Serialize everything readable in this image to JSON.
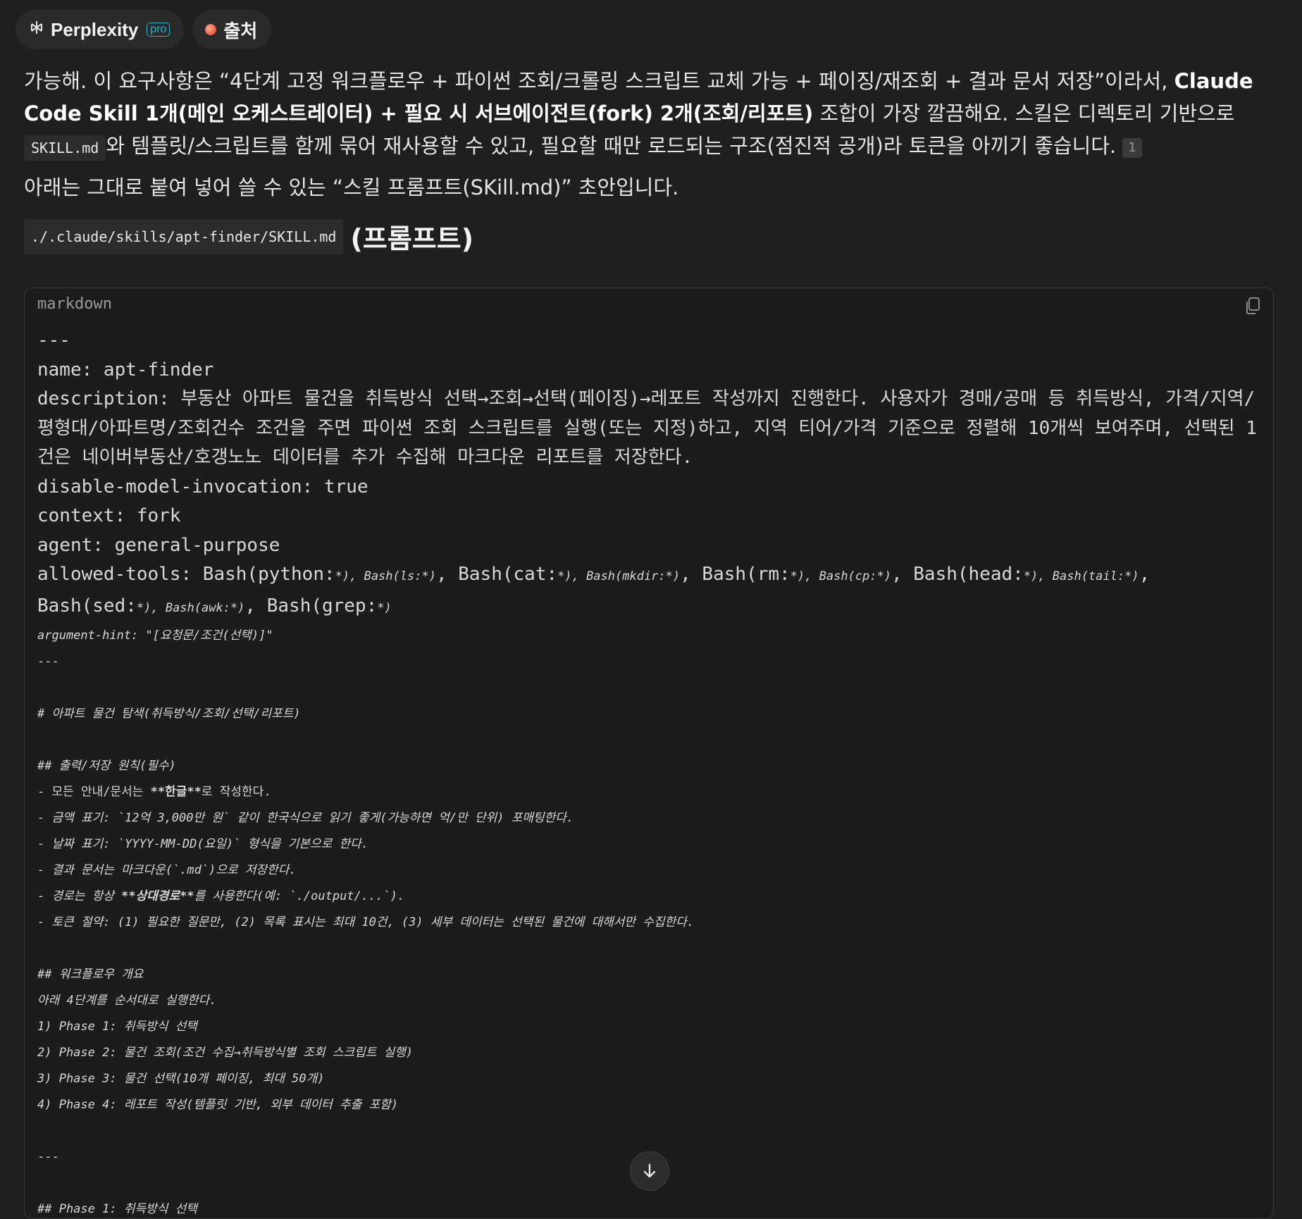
{
  "tabs": {
    "perplexity_label": "Perplexity",
    "pro_badge": "pro",
    "sources_label": "출처"
  },
  "answer": {
    "p1_part1": "가능해. 이 요구사항은 “4단계 고정 워크플로우 + 파이썬 조회/크롤링 스크립트 교체 가능 + 페이징/재조회 + 결과 문서 저장”이라서, ",
    "p1_bold": "Claude Code Skill 1개(메인 오케스트레이터) + 필요 시 서브에이전트(fork) 2개(조회/리포트)",
    "p1_part2": " 조합이 가장 깔끔해요. 스킬은 디렉토리 기반으로 ",
    "p1_code": "SKILL.md",
    "p1_part3": "와 템플릿/스크립트를 함께 묶어 재사용할 수 있고, 필요할 때만 로드되는 구조(점진적 공개)라 토큰을 아끼기 좋습니다.",
    "citation": "1",
    "p2": "아래는 그대로 붙여 넣어 쓸 수 있는 “스킬 프롬프트(SKill.md)” 초안입니다."
  },
  "heading": {
    "path": "./.claude/skills/apt-finder/SKILL.md",
    "text": "(프롬프트)"
  },
  "codeblock": {
    "language": "markdown",
    "fm_sep": "---",
    "name_line": "name: apt-finder",
    "description_line": "description: 부동산 아파트 물건을 취득방식 선택→조회→선택(페이징)→레포트 작성까지 진행한다. 사용자가 경매/공매 등 취득방식, 가격/지역/평형대/아파트명/조회건수 조건을 주면 파이썬 조회 스크립트를 실행(또는 지정)하고, 지역 티어/가격 기준으로 정렬해 10개씩 보여주며, 선택된 1건은 네이버부동산/호갱노노 데이터를 추가 수집해 마크다운 리포트를 저장한다.",
    "disable_line": "disable-model-invocation: true",
    "context_line": "context: fork",
    "agent_line": "agent: general-purpose",
    "tools_a1": "allowed-tools: Bash(python:",
    "tools_a2": "*), Bash(ls:*)",
    "tools_b1": ", Bash(cat:",
    "tools_b2": "*), Bash(mkdir:*)",
    "tools_c1": ", Bash(rm:",
    "tools_c2": "*), Bash(cp:*)",
    "tools_d1": ", Bash(head:",
    "tools_d2": "*), Bash(tail:*)",
    "tools_e1": ", Bash(sed:",
    "tools_e2": "*), Bash(awk:*)",
    "tools_f1": ", Bash(grep:",
    "tools_f2": "*)",
    "argument_hint": "argument-hint: \"[요청문/조건(선택)]\"",
    "fm_end": "---",
    "title_line": "# 아파트 물건 탐색(취득방식/조회/선택/리포트)",
    "section1": "## 출력/저장 원칙(필수)",
    "rule1_pre": "- 모든 안내/문서는 ",
    "rule1_bold": "**한글**",
    "rule1_post": "로 작성한다.",
    "rule2": "- 금액 표기: `12억 3,000만 원` 같이 한국식으로 읽기 좋게(가능하면 억/만 단위) 포매팅한다.",
    "rule3": "- 날짜 표기: `YYYY-MM-DD(요일)` 형식을 기본으로 한다.",
    "rule4": "- 결과 문서는 마크다운(`.md`)으로 저장한다.",
    "rule5_pre": "- 경로는 항상 ",
    "rule5_bold": "**상대경로**",
    "rule5_post": "를 사용한다(예: `./output/...`).",
    "rule6": "- 토큰 절약: (1) 필요한 질문만, (2) 목록 표시는 최대 10건, (3) 세부 데이터는 선택된 물건에 대해서만 수집한다.",
    "section2": "## 워크플로우 개요",
    "overview": "아래 4단계를 순서대로 실행한다.",
    "phase1": "1) Phase 1: 취득방식 선택",
    "phase2": "2) Phase 2: 물건 조회(조건 수집→취득방식별 조회 스크립트 실행)",
    "phase3": "3) Phase 3: 물건 선택(10개 페이징, 최대 50개)",
    "phase4": "4) Phase 4: 레포트 작성(템플릿 기반, 외부 데이터 추출 포함)",
    "sep2": "---",
    "next_section": "## Phase 1: 취득방식 선택"
  }
}
